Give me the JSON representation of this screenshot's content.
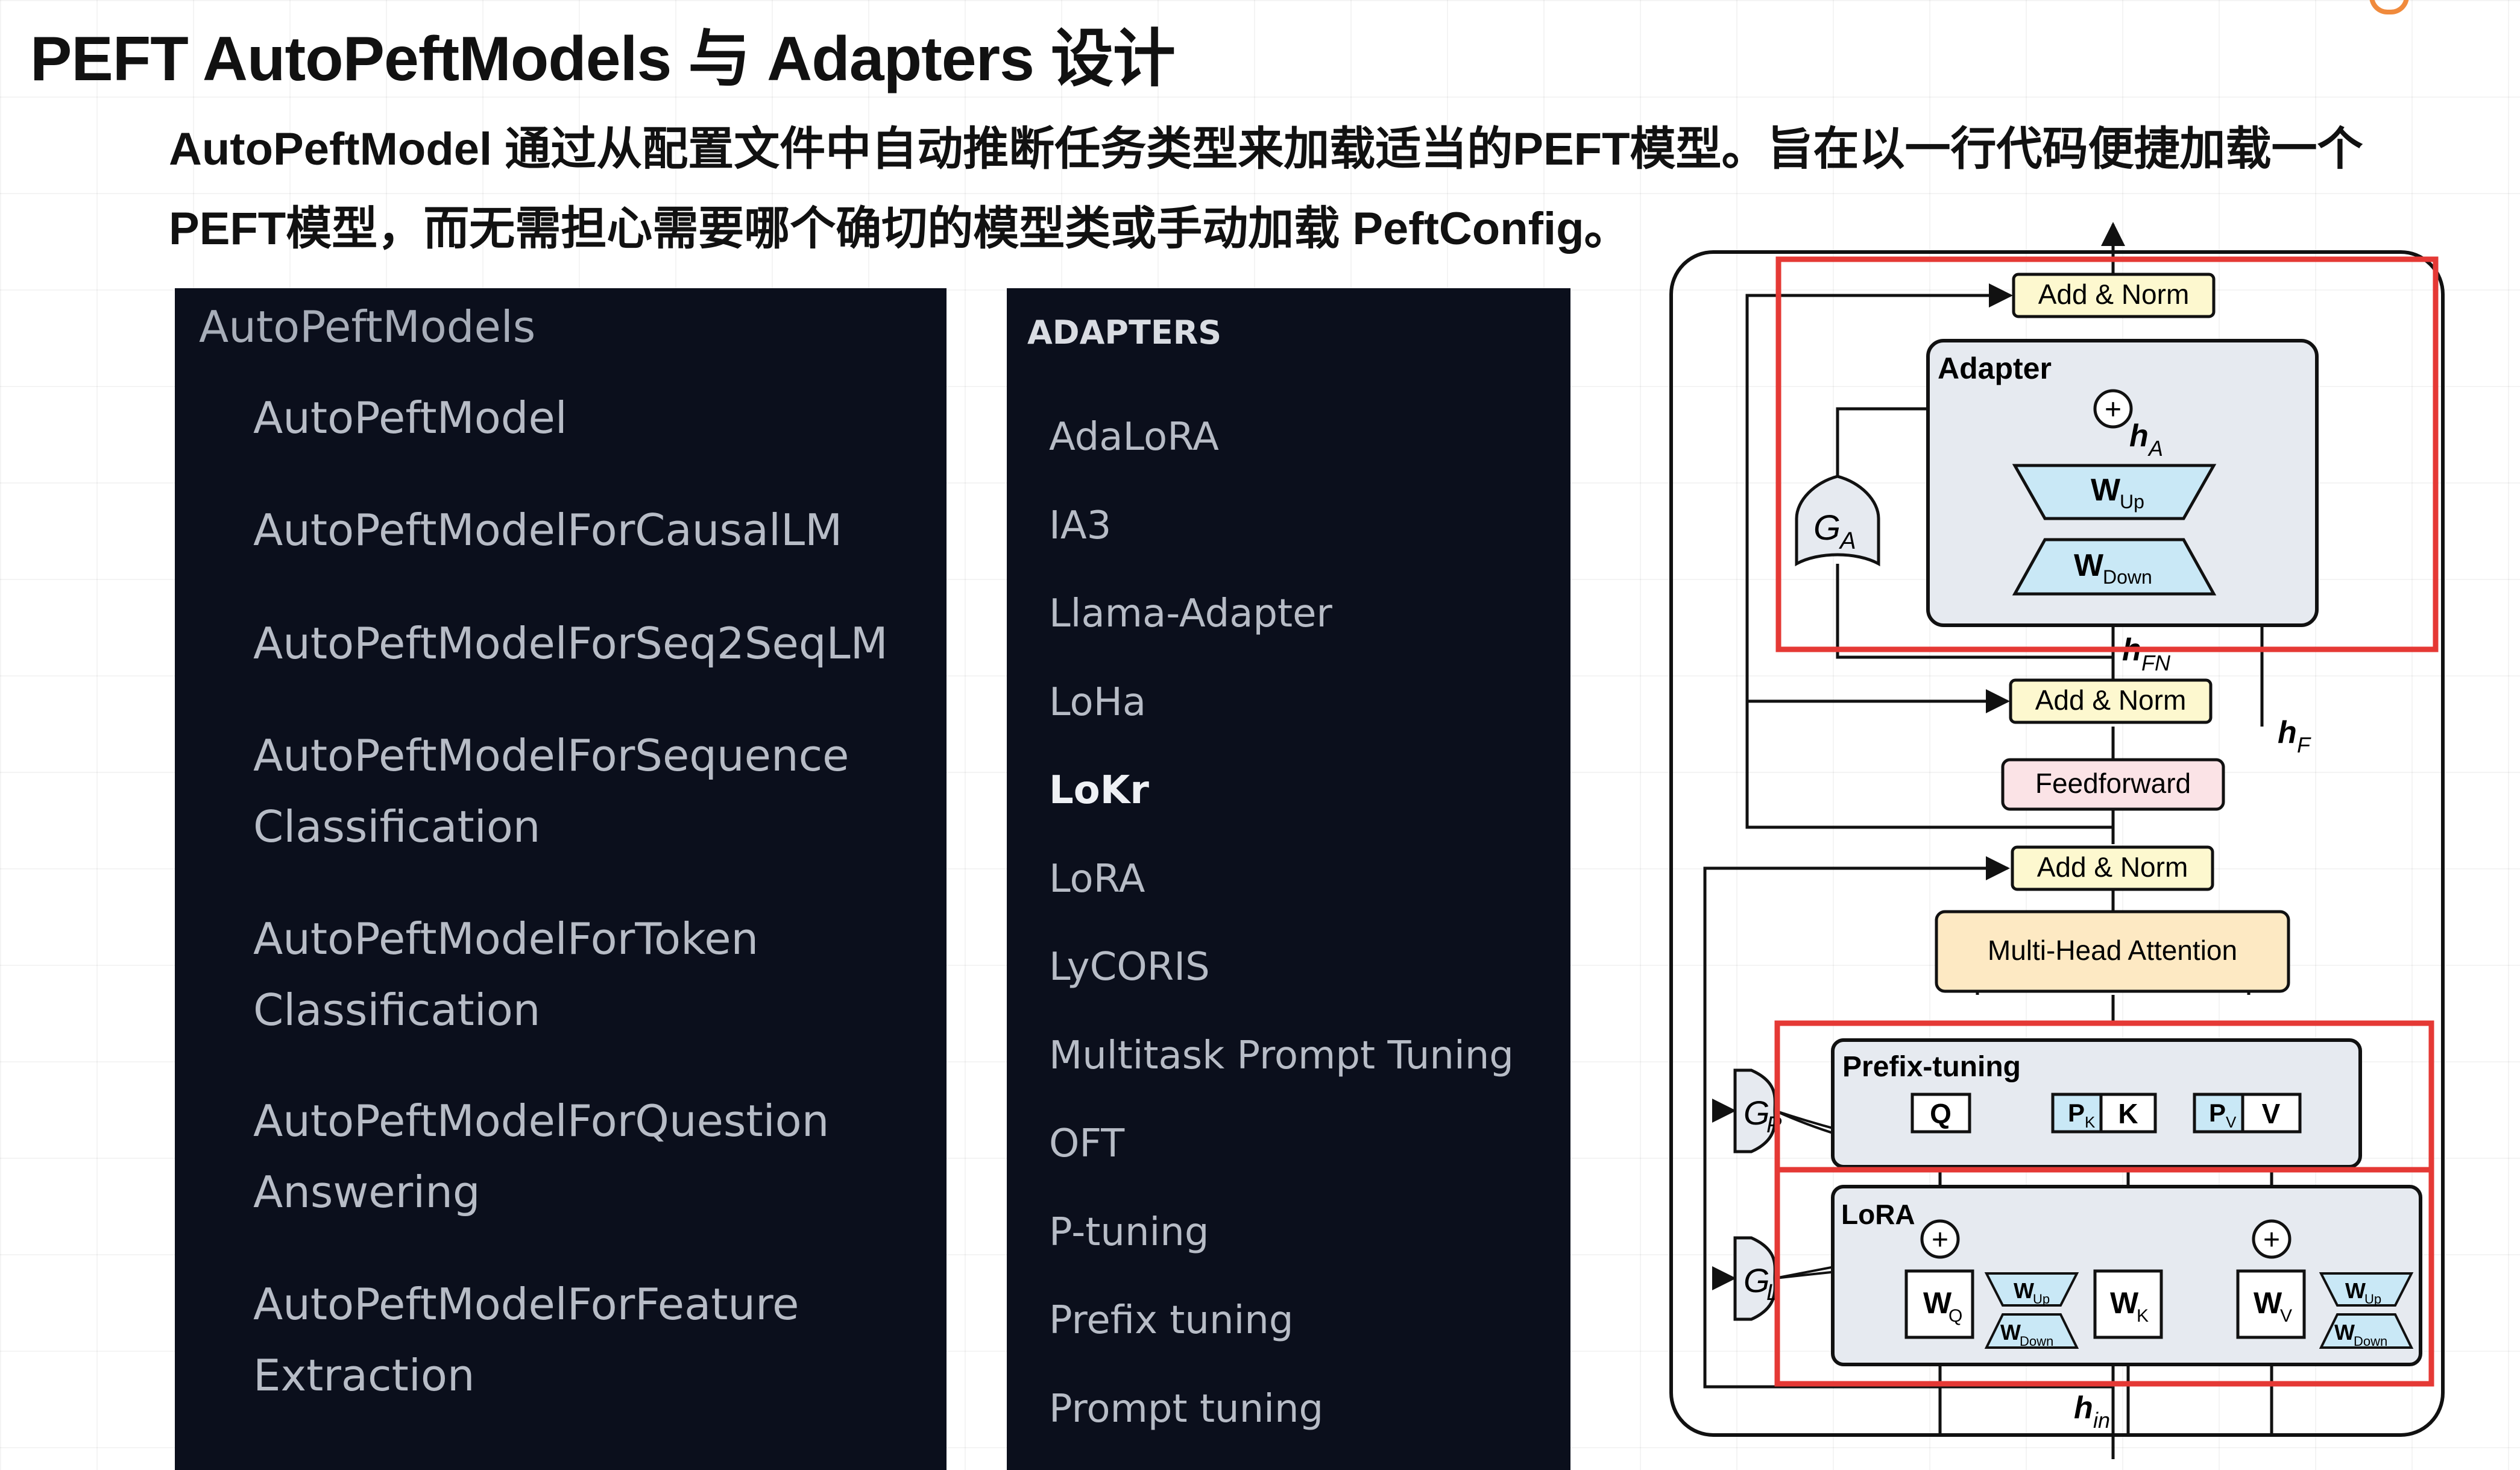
{
  "page": {
    "title": "PEFT AutoPeftModels 与 Adapters 设计",
    "intro": "AutoPeftModel 通过从配置文件中自动推断任务类型来加载适当的PEFT模型。旨在以一行代码便捷加载一个PEFT模型，而无需担心需要哪个确切的模型类或手动加载 PeftConfig。"
  },
  "models_panel": {
    "heading": "AutoPeftModels",
    "items": [
      {
        "line1": "AutoPeftModel",
        "line2": ""
      },
      {
        "line1": "AutoPeftModelForCausalLM",
        "line2": ""
      },
      {
        "line1": "AutoPeftModelForSeq2SeqLM",
        "line2": ""
      },
      {
        "line1": "AutoPeftModelForSequence",
        "line2": "Classification"
      },
      {
        "line1": "AutoPeftModelForToken",
        "line2": "Classification"
      },
      {
        "line1": "AutoPeftModelForQuestion",
        "line2": "Answering"
      },
      {
        "line1": "AutoPeftModelForFeature",
        "line2": "Extraction"
      }
    ]
  },
  "adapters_panel": {
    "heading": "ADAPTERS",
    "items": [
      "AdaLoRA",
      "IA3",
      "Llama-Adapter",
      "LoHa",
      "LoKr",
      "LoRA",
      "LyCORIS",
      "Multitask Prompt Tuning",
      "OFT",
      "P-tuning",
      "Prefix tuning",
      "Prompt tuning"
    ],
    "active_index": 4
  },
  "diagram": {
    "add_norm": "Add & Norm",
    "adapter_title": "Adapter",
    "w_up": "W",
    "up_sub": "Up",
    "w_down": "W",
    "down_sub": "Down",
    "feedforward": "Feedforward",
    "mha": "Multi-Head Attention",
    "prefix_title": "Prefix-tuning",
    "lora_title": "LoRA",
    "q": "Q",
    "k": "K",
    "v": "V",
    "p": "P",
    "k_sub": "K",
    "v_sub": "V",
    "q_sub": "Q",
    "h": "h",
    "sub_a": "A",
    "sub_fn": "FN",
    "sub_f": "F",
    "sub_in": "in",
    "gate": "G",
    "gate_a": "A",
    "gate_p": "P",
    "gate_l": "L",
    "plus": "+",
    "colors": {
      "highlight": "#e53935",
      "module_fill": "#e6eaf0",
      "add_norm_fill": "#fdf8cf",
      "ff_fill": "#fbe3e6",
      "mha_fill": "#fde9c3",
      "trap_fill": "#c9e8f6",
      "panel_bg": "#0b0f1c"
    }
  }
}
